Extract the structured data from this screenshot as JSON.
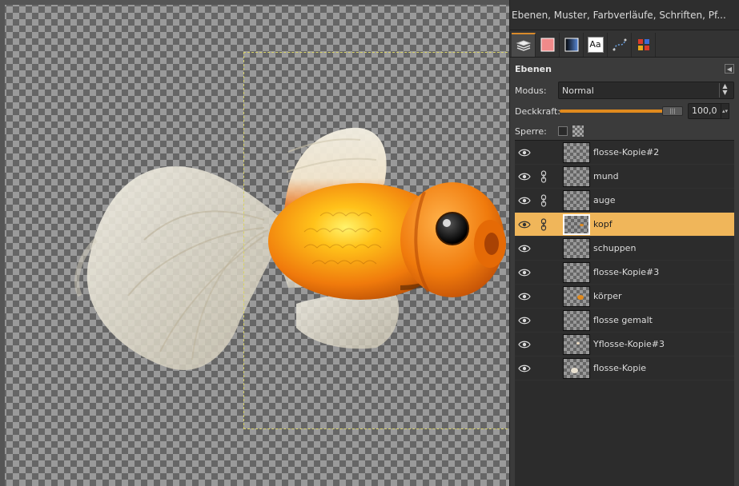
{
  "dock": {
    "title": "Ebenen, Muster, Farbverläufe, Schriften, Pf...",
    "tabs": [
      {
        "name": "layers",
        "icon": "layers-icon"
      },
      {
        "name": "patterns",
        "icon": "pattern-swatch-icon"
      },
      {
        "name": "gradients",
        "icon": "gradient-icon"
      },
      {
        "name": "fonts",
        "icon": "font-icon",
        "label": "Aa"
      },
      {
        "name": "paths",
        "icon": "paths-icon"
      },
      {
        "name": "palettes",
        "icon": "palette-icon"
      }
    ],
    "panel_title": "Ebenen",
    "mode_label": "Modus:",
    "mode_value": "Normal",
    "opacity_label": "Deckkraft:",
    "opacity_value": "100,0",
    "opacity_fraction": 1.0,
    "lock_label": "Sperre:"
  },
  "layers": [
    {
      "name": "flosse-Kopie#2",
      "visible": true,
      "linked": false,
      "selected": false
    },
    {
      "name": "mund",
      "visible": true,
      "linked": true,
      "selected": false
    },
    {
      "name": "auge",
      "visible": true,
      "linked": true,
      "selected": false
    },
    {
      "name": "kopf",
      "visible": true,
      "linked": true,
      "selected": true
    },
    {
      "name": "schuppen",
      "visible": true,
      "linked": false,
      "selected": false
    },
    {
      "name": "flosse-Kopie#3",
      "visible": true,
      "linked": false,
      "selected": false
    },
    {
      "name": "körper",
      "visible": true,
      "linked": false,
      "selected": false
    },
    {
      "name": "flosse gemalt",
      "visible": true,
      "linked": false,
      "selected": false
    },
    {
      "name": "Yflosse-Kopie#3",
      "visible": true,
      "linked": false,
      "selected": false
    },
    {
      "name": "flosse-Kopie",
      "visible": true,
      "linked": false,
      "selected": false
    }
  ],
  "colors": {
    "accent": "#e08a1e",
    "selection": "#f0b65a",
    "fish_orange": "#f28a10",
    "fish_yellow": "#ffd21a",
    "fin_white": "#e8e4d8"
  }
}
